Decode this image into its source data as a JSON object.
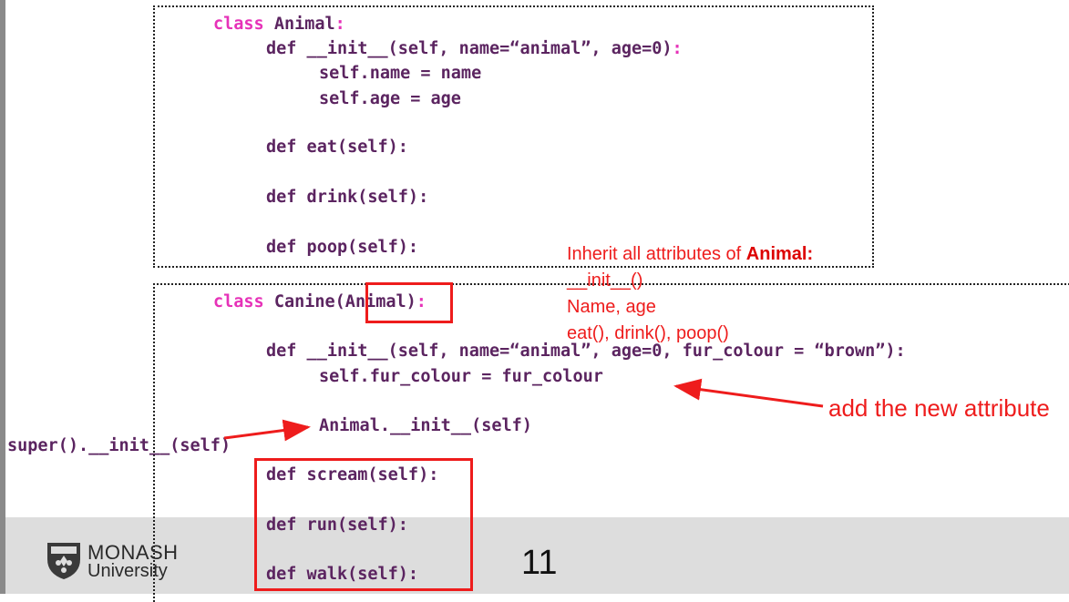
{
  "animal_class": {
    "line_class_kw": "class",
    "line_class_name": " Animal",
    "line_class_colon": ":",
    "line_init": "def __init__(self, name=“animal”, age=0)",
    "line_init_colon": ":",
    "line_name": "self.name = name",
    "line_age": "self.age = age",
    "line_eat": "def eat(self):",
    "line_drink": "def drink(self):",
    "line_poop": "def poop(self):"
  },
  "canine_class": {
    "line_class_kw": "class",
    "line_class_name": " Canine(Animal)",
    "line_class_colon": ":",
    "line_init": "def __init__(self, name=“animal”, age=0, fur_colour = “brown”):",
    "line_fur": "self.fur_colour = fur_colour",
    "line_super_call": "Animal.__init__(self)",
    "line_scream": "def scream(self):",
    "line_run": "def run(self):",
    "line_walk": "def walk(self):"
  },
  "side_code": "super().__init__(self)",
  "annotations": {
    "inherit_prefix": "Inherit all attributes of ",
    "inherit_bold": "Animal:",
    "init_item": "__init__()",
    "attrs_item": "Name, age",
    "methods_item": "eat(), drink(), poop()",
    "new_attribute": "add the new attribute"
  },
  "footer": {
    "logo_line1": "MONASH",
    "logo_line2": "University",
    "page_number": "11"
  },
  "colors": {
    "annotation_red": "#ee1c1c",
    "code_purple": "#5b2460",
    "keyword_pink": "#e632b8",
    "footer_band": "#dddddd"
  }
}
